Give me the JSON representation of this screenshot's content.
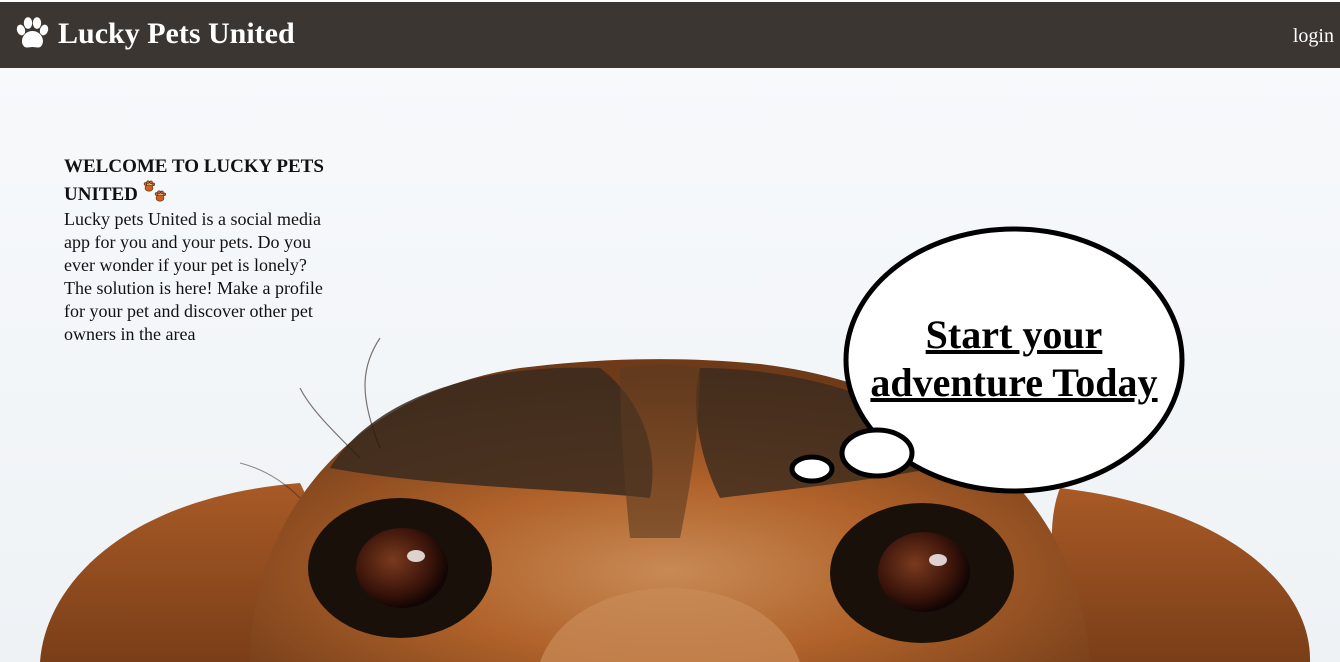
{
  "navbar": {
    "brand": "Lucky Pets United",
    "brand_icon": "paw-icon",
    "login_label": "login",
    "background": "#3b3632"
  },
  "welcome": {
    "title": "WELCOME TO LUCKY PETS UNITED",
    "title_icon": "paw-prints-icon",
    "body": "Lucky pets United is a social media app for you and your pets. Do you ever wonder if your pet is lonely? The solution is here! Make a profile for your pet and discover other pet owners in the area"
  },
  "cta": {
    "label": "Start your adventure Today"
  },
  "colors": {
    "fur_orange": "#b0622a",
    "fur_dark": "#3a2a1e",
    "accent_paw": "#d2601a"
  }
}
